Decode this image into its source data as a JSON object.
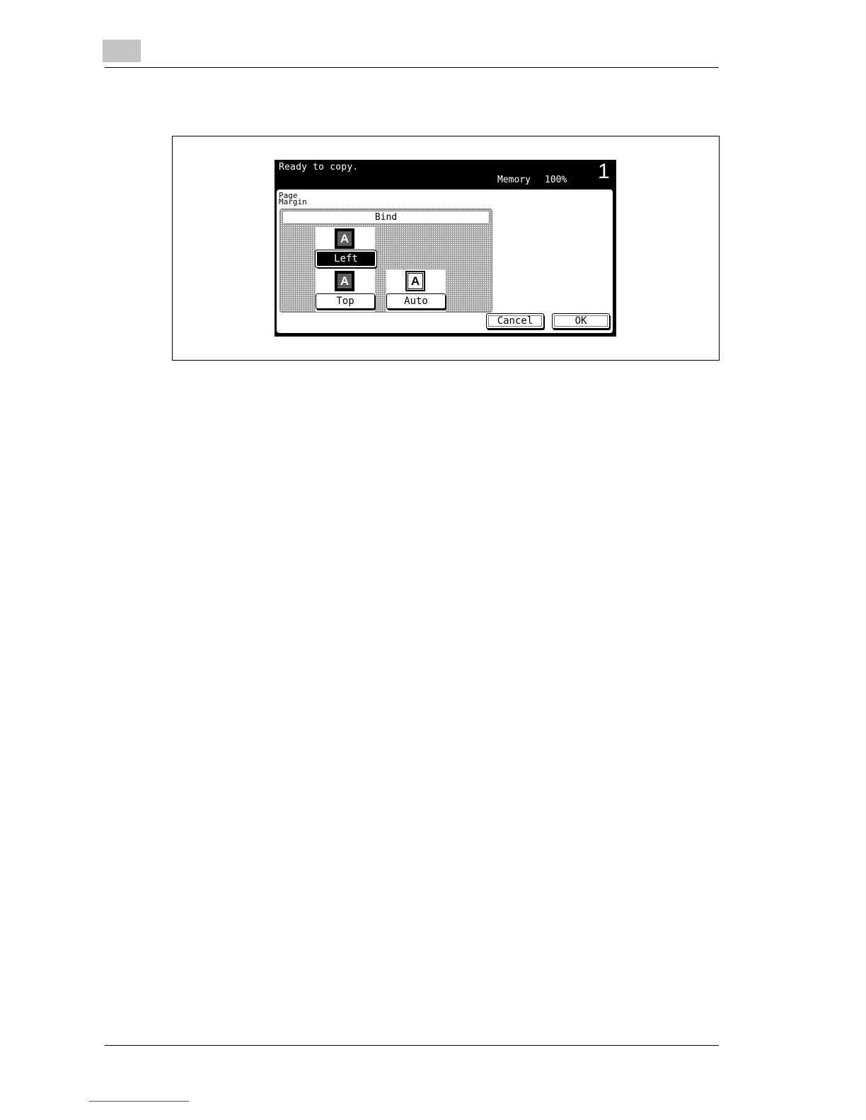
{
  "screen": {
    "status_text": "Ready to copy.",
    "memory_label": "Memory",
    "memory_value": "100%",
    "count": "1"
  },
  "panel": {
    "title": "Page\nMargin",
    "bind_header": "Bind",
    "options": {
      "left": "Left",
      "top": "Top",
      "auto": "Auto"
    },
    "icon_letter": "A",
    "selected_option": "Left",
    "cancel_label": "Cancel",
    "ok_label": "OK"
  },
  "colors": {
    "screen_background": "#000000",
    "selected_button": "#000000",
    "footer_link": "#2b4fd6",
    "chapter_box": "#c4c4c4"
  }
}
